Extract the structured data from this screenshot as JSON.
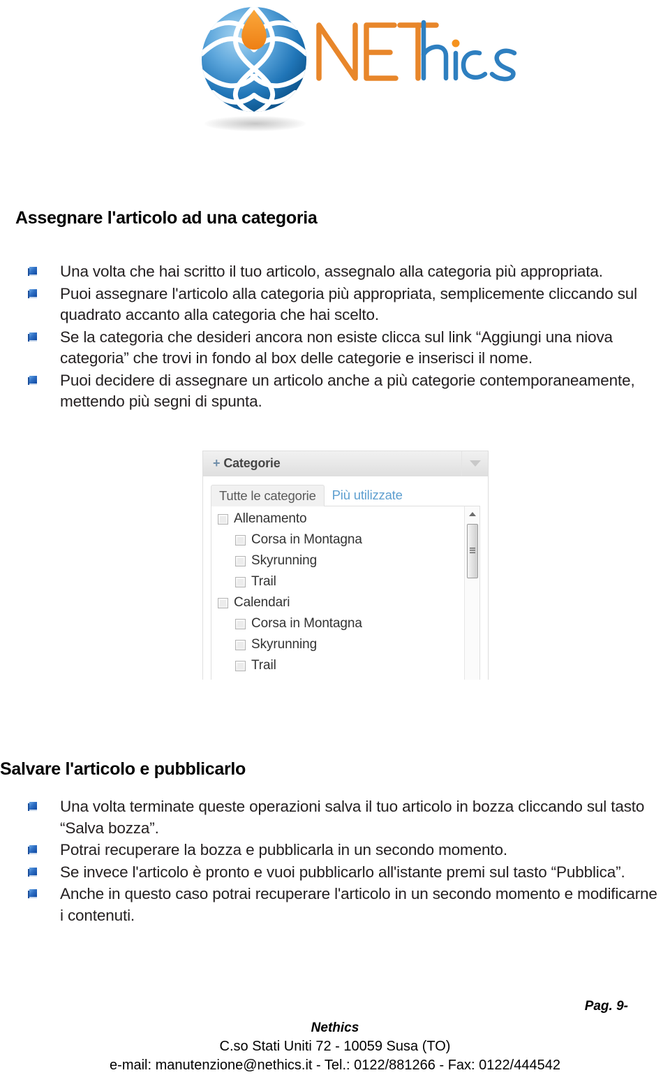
{
  "logo": {
    "brand_net": "NET",
    "brand_hics": "hics",
    "orange": "#E8862A",
    "blue": "#2E7FC0",
    "globe_blue_light": "#8fc4e8",
    "globe_blue_dark": "#0d5c96",
    "drop_orange": "#F5921E",
    "icon_globe": "globe-network-icon",
    "icon_drop": "teardrop-icon"
  },
  "sections": [
    {
      "heading": "Assegnare l'articolo ad una categoria",
      "bullets": [
        "Una volta che hai scritto il tuo articolo, assegnalo alla categoria più appropriata.",
        "Puoi assegnare l'articolo alla categoria più appropriata, semplicemente cliccando sul quadrato accanto alla categoria che hai scelto.",
        "Se la categoria che desideri ancora non esiste clicca sul link “Aggiungi una niova categoria” che trovi in fondo al box delle categorie e inserisci il nome.",
        "Puoi decidere di assegnare un articolo anche a più categorie contemporaneamente, mettendo più segni di spunta."
      ]
    },
    {
      "heading": "Salvare l'articolo e pubblicarlo",
      "bullets": [
        "Una volta terminate queste operazioni salva il tuo articolo in bozza cliccando sul tasto “Salva bozza”.",
        "Potrai recuperare la bozza e pubblicarla in un secondo momento.",
        "Se invece l'articolo è pronto e vuoi pubblicarlo all'istante premi sul tasto “Pubblica”.",
        "Anche in questo caso potrai recuperare l'articolo in un secondo momento e modificarne i contenuti."
      ]
    }
  ],
  "categories_widget": {
    "handle_plus": "+",
    "handle_title": "Categorie",
    "toggle_icon": "chevron-down-icon",
    "tabs": [
      {
        "label": "Tutte le categorie",
        "active": true
      },
      {
        "label": "Più utilizzate",
        "active": false
      }
    ],
    "items": [
      {
        "label": "Allenamento",
        "level": 0,
        "checked": false
      },
      {
        "label": "Corsa in Montagna",
        "level": 1,
        "checked": false
      },
      {
        "label": "Skyrunning",
        "level": 1,
        "checked": false
      },
      {
        "label": "Trail",
        "level": 1,
        "checked": false
      },
      {
        "label": "Calendari",
        "level": 0,
        "checked": false
      },
      {
        "label": "Corsa in Montagna",
        "level": 1,
        "checked": false
      },
      {
        "label": "Skyrunning",
        "level": 1,
        "checked": false
      },
      {
        "label": "Trail",
        "level": 1,
        "checked": false
      }
    ],
    "scrollbar": {
      "up_arrow_icon": "scroll-up-arrow-icon",
      "thumb_icon": "scrollbar-thumb-grip-icon"
    }
  },
  "footer": {
    "page_number": "Pag. 9-",
    "company": "Nethics",
    "address": "C.so Stati Uniti 72 - 10059 Susa (TO)",
    "contact": "e-mail: manutenzione@nethics.it  -  Tel.: 0122/881266 - Fax: 0122/444542"
  }
}
